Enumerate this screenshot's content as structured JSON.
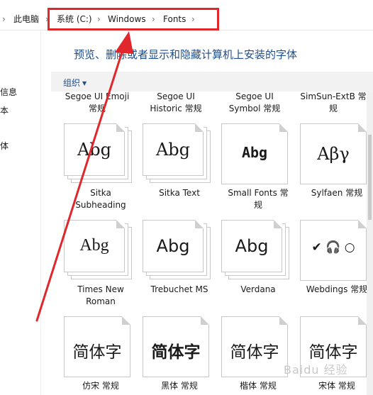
{
  "breadcrumb": {
    "items": [
      "此电脑",
      "系统 (C:)",
      "Windows",
      "Fonts"
    ],
    "separator": "›"
  },
  "nav": {
    "fragments": [
      "信息",
      "本",
      "体"
    ]
  },
  "page": {
    "title": "预览、删除或者显示和隐藏计算机上安装的字体"
  },
  "toolbar": {
    "organize_label": "组织"
  },
  "top_row_labels": [
    [
      "Segoe UI Emoji",
      "常规"
    ],
    [
      "Segoe UI",
      "Historic 常规"
    ],
    [
      "Segoe UI",
      "Symbol 常规"
    ],
    [
      "SimSun-ExtB 常",
      "规"
    ]
  ],
  "fonts": [
    {
      "glyph": "Abg",
      "name_lines": [
        "Sitka",
        "Subheading"
      ],
      "stacked": true
    },
    {
      "glyph": "Abg",
      "name_lines": [
        "Sitka Text"
      ],
      "stacked": true
    },
    {
      "glyph": "Abg",
      "name_lines": [
        "Small Fonts 常",
        "规"
      ],
      "stacked": false
    },
    {
      "glyph": "Αβγ",
      "name_lines": [
        "Sylfaen 常规"
      ],
      "stacked": false
    },
    {
      "glyph": "Abg",
      "name_lines": [
        "Times New",
        "Roman"
      ],
      "stacked": true
    },
    {
      "glyph": "Abg",
      "name_lines": [
        "Trebuchet MS"
      ],
      "stacked": true
    },
    {
      "glyph": "Abg",
      "name_lines": [
        "Verdana"
      ],
      "stacked": true
    },
    {
      "glyph": "✔ 🎧 ○",
      "name_lines": [
        "Webdings 常规"
      ],
      "stacked": false
    },
    {
      "glyph": "简体字",
      "name_lines": [
        "仿宋 常规"
      ],
      "stacked": false
    },
    {
      "glyph": "简体字",
      "name_lines": [
        "黑体 常规"
      ],
      "stacked": false
    },
    {
      "glyph": "简体字",
      "name_lines": [
        "楷体 常规"
      ],
      "stacked": false
    },
    {
      "glyph": "简体字",
      "name_lines": [
        "宋体 常规"
      ],
      "stacked": false
    }
  ],
  "watermark": "Baidu 经验",
  "colors": {
    "highlight_box": "#e0272b",
    "annotation_arrow": "#e0272b",
    "title_blue": "#1e4e8c"
  }
}
